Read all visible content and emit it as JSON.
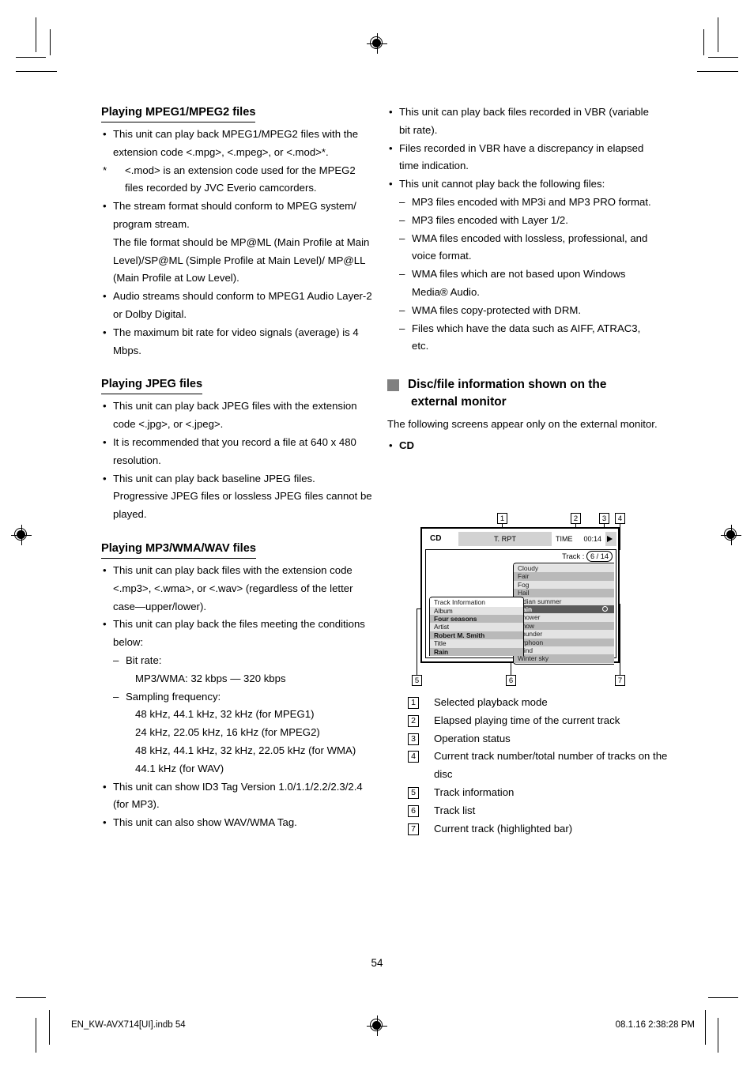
{
  "page": {
    "number": "54",
    "footer_left": "EN_KW-AVX714[UI].indb   54",
    "footer_right": "08.1.16   2:38:28 PM"
  },
  "left_column": {
    "section1": {
      "heading": "Playing MPEG1/MPEG2 files",
      "items": [
        "This unit can play back MPEG1/MPEG2 files with the extension code <.mpg>, <.mpeg>, or <.mod>*.",
        "<.mod> is an extension code used for the MPEG2 files recorded by JVC Everio camcorders.",
        "The stream format should conform to MPEG system/ program stream.",
        "The file format should be MP@ML (Main Profile at Main Level)/SP@ML (Simple Profile at Main Level)/ MP@LL (Main Profile at Low Level).",
        "Audio streams should conform to MPEG1 Audio Layer-2 or Dolby Digital.",
        "The maximum bit rate for video signals (average) is 4 Mbps."
      ],
      "star": "*"
    },
    "section2": {
      "heading": "Playing JPEG files",
      "items": [
        "This unit can play back JPEG files with the extension code <.jpg>, or <.jpeg>.",
        "It is recommended that you record a file at 640 x 480 resolution.",
        "This unit can play back baseline JPEG files.",
        "Progressive JPEG files or lossless JPEG files cannot be played."
      ]
    },
    "section3": {
      "heading": "Playing MP3/WMA/WAV files",
      "item1": "This unit can play back files with the extension code <.mp3>, <.wma>, or <.wav> (regardless of the letter case—upper/lower).",
      "item2": "This unit can play back the files meeting the conditions below:",
      "subs": [
        "Bit rate:",
        "Sampling frequency:"
      ],
      "bitrate_value": "MP3/WMA: 32 kbps — 320 kbps",
      "sampling_values": [
        "48 kHz, 44.1 kHz, 32 kHz (for MPEG1)",
        "24 kHz, 22.05 kHz, 16 kHz (for MPEG2)",
        "48 kHz, 44.1 kHz, 32 kHz, 22.05 kHz (for WMA)",
        "44.1 kHz (for WAV)"
      ],
      "item3": "This unit can show ID3 Tag Version 1.0/1.1/2.2/2.3/2.4 (for MP3).",
      "item4": "This unit can also show WAV/WMA Tag."
    }
  },
  "right_column": {
    "items": [
      "This unit can play back files recorded in VBR (variable bit rate).",
      "Files recorded in VBR have a discrepancy in elapsed time indication.",
      "This unit cannot play back the following files:"
    ],
    "cannot_play": [
      "MP3 files encoded with MP3i and MP3 PRO format.",
      "MP3 files encoded with Layer 1/2.",
      "WMA files encoded with lossless, professional, and voice format.",
      "WMA files which are not based upon Windows Media® Audio.",
      "WMA files copy-protected with DRM.",
      "Files which have the data such as AIFF, ATRAC3, etc."
    ],
    "big_heading_line1": "Disc/file information shown on the",
    "big_heading_line2": "external monitor",
    "intro": "The following screens appear only on the external monitor.",
    "cd_label": "CD"
  },
  "figure": {
    "callouts": [
      "1",
      "2",
      "3",
      "4",
      "5",
      "6",
      "7"
    ],
    "topbar": {
      "source": "CD",
      "mode": "T. RPT",
      "time_label": "TIME",
      "time_value": "00:14",
      "play_icon": "play-icon"
    },
    "track_counter": {
      "label": "Track :",
      "value": "6 / 14"
    },
    "track_list": [
      {
        "name": "Cloudy",
        "shade": "light"
      },
      {
        "name": "Fair",
        "shade": "dark"
      },
      {
        "name": "Fog",
        "shade": "light"
      },
      {
        "name": "Hail",
        "shade": "dark"
      },
      {
        "name": "Indian summer",
        "shade": "light"
      },
      {
        "name": "Rain",
        "shade": "sel"
      },
      {
        "name": "Shower",
        "shade": "light"
      },
      {
        "name": "Snow",
        "shade": "dark"
      },
      {
        "name": "Thunder",
        "shade": "light"
      },
      {
        "name": "Typhoon",
        "shade": "dark"
      },
      {
        "name": "Wind",
        "shade": "light"
      },
      {
        "name": "Winter sky",
        "shade": "dark"
      }
    ],
    "track_information": [
      {
        "text": "Track Information",
        "shade": "hdr"
      },
      {
        "text": "Album",
        "shade": "light"
      },
      {
        "text": "Four seasons",
        "shade": "dark"
      },
      {
        "text": "Artist",
        "shade": "light"
      },
      {
        "text": "Robert M. Smith",
        "shade": "dark"
      },
      {
        "text": "Title",
        "shade": "light"
      },
      {
        "text": "Rain",
        "shade": "dark"
      }
    ]
  },
  "legend": [
    {
      "num": "1",
      "text": "Selected playback mode"
    },
    {
      "num": "2",
      "text": "Elapsed playing time of the current track"
    },
    {
      "num": "3",
      "text": "Operation status"
    },
    {
      "num": "4",
      "text": "Current track number/total number of tracks on the disc"
    },
    {
      "num": "5",
      "text": "Track information"
    },
    {
      "num": "6",
      "text": "Track list"
    },
    {
      "num": "7",
      "text": "Current track (highlighted bar)"
    }
  ],
  "colors": {
    "heading_square": "#808080",
    "row_light": "#e3e3e3",
    "row_dark": "#b9b9b9",
    "row_selected": "#5a5a5a",
    "topbar_bg": "#d2d2d2"
  }
}
